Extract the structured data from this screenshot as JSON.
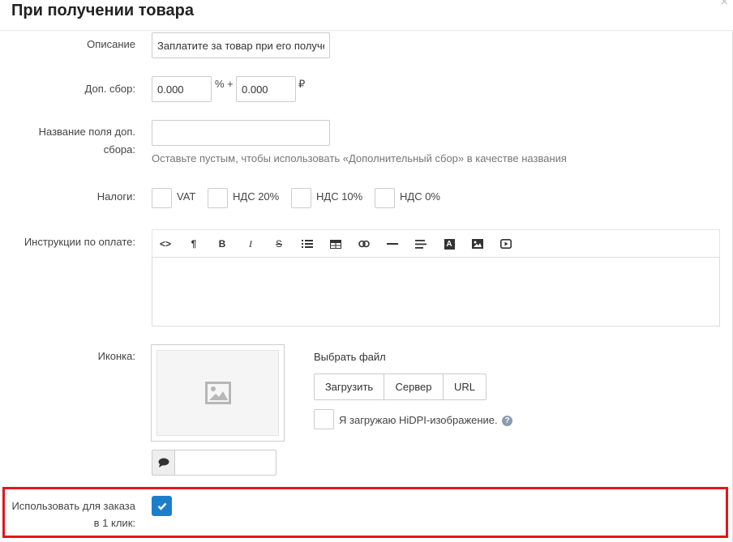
{
  "dialog": {
    "title": "При получении товара"
  },
  "description": {
    "label": "Описание",
    "value": "Заплатите за товар при его получении"
  },
  "surcharge": {
    "label": "Доп. сбор:",
    "percent_value": "0.000",
    "percent_suffix": "% +",
    "fixed_value": "0.000",
    "currency_suffix": "₽"
  },
  "surcharge_name": {
    "label_line1": "Название поля доп.",
    "label_line2": "сбора:",
    "value": "",
    "hint": "Оставьте пустым, чтобы использовать «Дополнительный сбор» в качестве названия"
  },
  "taxes": {
    "label": "Налоги:",
    "options": [
      "VAT",
      "НДС 20%",
      "НДС 10%",
      "НДС 0%"
    ]
  },
  "instructions": {
    "label": "Инструкции по оплате:",
    "toolbar": [
      "code-icon",
      "paragraph-icon",
      "bold-icon",
      "italic-icon",
      "strikethrough-icon",
      "unordered-list-icon",
      "table-icon",
      "link-icon",
      "horizontal-rule-icon",
      "align-icon",
      "font-color-icon",
      "image-icon",
      "video-icon"
    ],
    "toolbar_glyphs": {
      "code": "<>",
      "paragraph": "¶",
      "bold": "B",
      "italic": "I",
      "strike": "S",
      "font": "A"
    }
  },
  "icon": {
    "label": "Иконка:",
    "choose_file": "Выбрать файл",
    "buttons": {
      "upload": "Загрузить",
      "server": "Сервер",
      "url": "URL"
    },
    "hidpi_label": "Я загружаю HiDPI-изображение.",
    "help": "?",
    "alt_value": ""
  },
  "one_click": {
    "label_line1": "Использовать для заказа",
    "label_line2": "в 1 клик:",
    "checked": true
  },
  "colors": {
    "accent": "#1d7fcc",
    "highlight": "#e8141a"
  }
}
